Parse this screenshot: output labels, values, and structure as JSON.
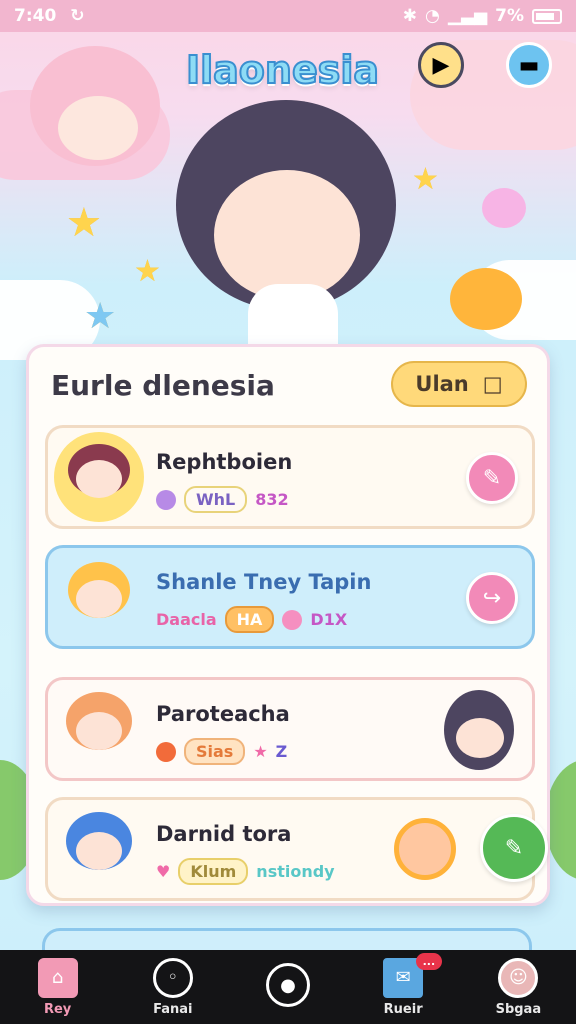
{
  "status_bar": {
    "time": "7:40",
    "battery": "7%"
  },
  "header": {
    "title": "Ilaonesia"
  },
  "card": {
    "title": "Eurle dlenesia",
    "action_label": "Ulan",
    "rows": [
      {
        "name": "Rephtboien",
        "meta": [
          "WhL",
          "832"
        ]
      },
      {
        "name": "Shanle Tney Tapin",
        "meta": [
          "Daacla",
          "HA",
          "D1X"
        ]
      },
      {
        "name": "Paroteacha",
        "meta": [
          "Sias",
          "Z"
        ]
      },
      {
        "name": "Darnid tora",
        "meta": [
          "Klum",
          "nstiondy"
        ]
      }
    ]
  },
  "nav": {
    "items": [
      {
        "label": "Rey"
      },
      {
        "label": "Fanai"
      },
      {
        "label": ""
      },
      {
        "label": "Rueir",
        "badge": "..."
      },
      {
        "label": "Sbgaa"
      }
    ]
  },
  "colors": {
    "accent_pink": "#f28ab8",
    "accent_yellow": "#ffd97a",
    "accent_green": "#55b956",
    "nav_bg": "#141416"
  }
}
